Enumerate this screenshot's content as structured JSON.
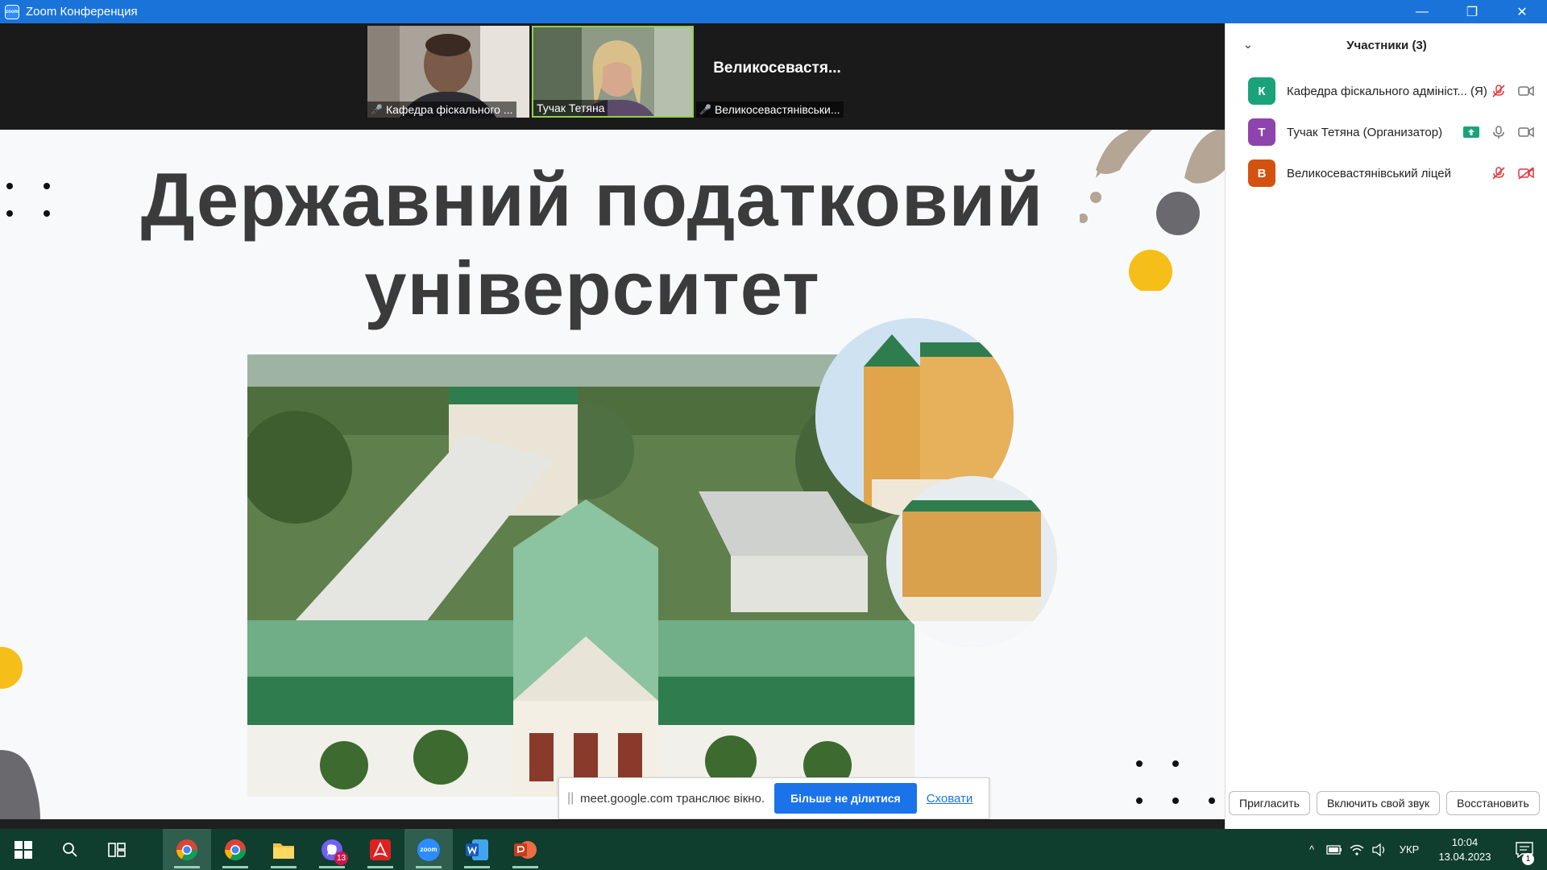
{
  "window": {
    "title": "Zoom Конференция",
    "minimize": "—",
    "restore": "❐",
    "close": "✕"
  },
  "videos": [
    {
      "name": "Кафедра фіскального ...",
      "muted": true
    },
    {
      "name": "Тучак Тетяна",
      "muted": false,
      "active": true
    },
    {
      "name": "Великосевастянівськи...",
      "big_name": "Великосевастя...",
      "muted": true
    }
  ],
  "slide": {
    "title_line1": "Державний податковий",
    "title_line2": "університет"
  },
  "share_banner": {
    "message": "meet.google.com транслює вікно.",
    "stop_label": "Більше не ділитися",
    "hide_label": "Сховати"
  },
  "participants_panel": {
    "title": "Участники (3)",
    "participants": [
      {
        "initial": "К",
        "name": "Кафедра фіскального адмініст... (Я)",
        "color": "#1aa37a",
        "mic": "off",
        "video": "on"
      },
      {
        "initial": "Т",
        "name": "Тучак Тетяна (Организатор)",
        "color": "#8e44ad",
        "mic": "on",
        "video": "on",
        "sharing": true
      },
      {
        "initial": "В",
        "name": "Великосевастянівський ліцей",
        "color": "#d4520f",
        "mic": "off",
        "video": "off"
      }
    ],
    "actions": {
      "invite": "Пригласить",
      "unmute": "Включить свой звук",
      "restore": "Восстановить"
    }
  },
  "taskbar": {
    "viber_badge": "13",
    "zoom_label": "zoom",
    "language": "УКР",
    "time": "10:04",
    "date": "13.04.2023",
    "notifications": "1"
  }
}
